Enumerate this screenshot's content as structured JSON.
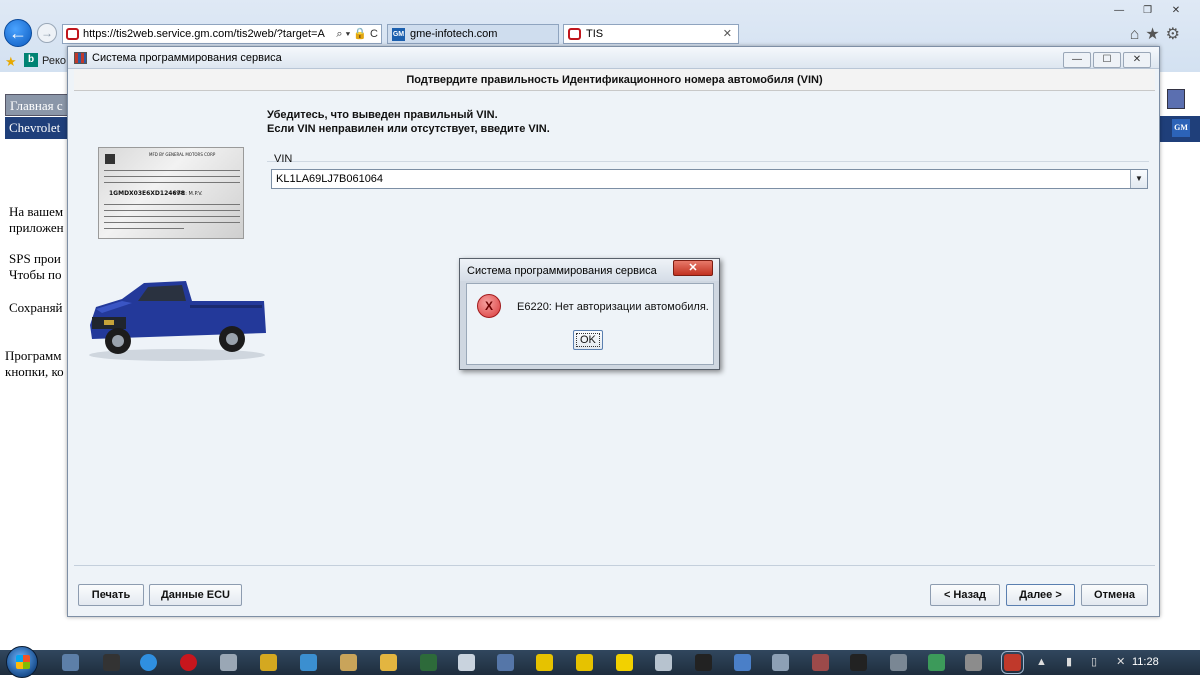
{
  "browser": {
    "address_url": "https://tis2web.service.gm.com/tis2web/?target=A",
    "address_controls": "⌕ ▾ 🔒 C",
    "tabs": [
      {
        "label": "gme-infotech.com"
      },
      {
        "label": "TIS"
      }
    ],
    "favorites_bar_text": "Реко"
  },
  "background_page": {
    "nav_home": "Главная с",
    "nav_brand": "Chevrolet (",
    "text_lines": [
      "На вашем",
      "приложен",
      "SPS прои",
      "Чтобы по",
      "Сохраняй",
      "Программ",
      "кнопки, ко"
    ]
  },
  "sps": {
    "window_title": "Система программирования сервиса",
    "header": "Подтвердите правильность Идентификационного номера автомобиля (VIN)",
    "instruction_1": "Убедитесь, что выведен правильный VIN.",
    "instruction_2": "Если VIN неправилен или отсутствует, введите VIN.",
    "vin_label": "VIN",
    "vin_value": "KL1LA69LJ7B061064",
    "sticker": {
      "header": "MFD BY GENERAL MOTORS CORP",
      "vin": "1GMDX03E6XD124678",
      "type": "TYPE: M.P.V."
    },
    "buttons": {
      "print": "Печать",
      "ecu_data": "Данные ECU",
      "back": "< Назад",
      "next": "Далее >",
      "cancel": "Отмена"
    }
  },
  "error_dialog": {
    "title": "Система программирования сервиса",
    "message": "E6220: Нет авторизации автомобиля.",
    "ok_label": "OK"
  },
  "taskbar": {
    "clock": "11:28"
  },
  "colors": {
    "accent": "#1f3f7a",
    "error": "#d9383a"
  }
}
